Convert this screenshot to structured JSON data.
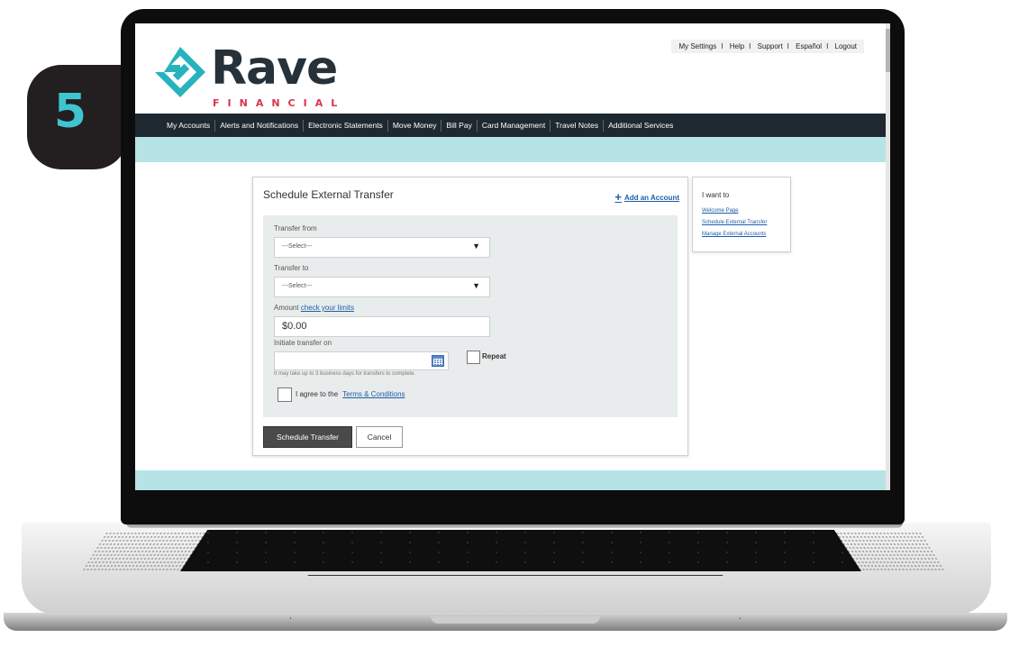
{
  "step": {
    "number": "5"
  },
  "brand": {
    "name": "Rave",
    "tagline": "FINANCIAL",
    "accent": "#26b3bd",
    "secondary": "#d8364b",
    "dark": "#26313a"
  },
  "utility_nav": [
    "My Settings",
    "Help",
    "Support",
    "Español",
    "Logout"
  ],
  "main_nav": [
    "My Accounts",
    "Alerts and Notifications",
    "Electronic Statements",
    "Move Money",
    "Bill Pay",
    "Card Management",
    "Travel Notes",
    "Additional Services"
  ],
  "form": {
    "title": "Schedule External Transfer",
    "add_account": "Add an Account",
    "transfer_from_label": "Transfer from",
    "transfer_from_value": "---Select---",
    "transfer_to_label": "Transfer to",
    "transfer_to_value": "---Select---",
    "amount_label": "Amount",
    "amount_link": "check your limits",
    "amount_value": "$0.00",
    "date_label": "Initiate transfer on",
    "date_value": "",
    "repeat_label": "Repeat",
    "note": "It may take up to 3 business days for transfers to complete.",
    "agree_label": "I agree to the",
    "terms_link": "Terms & Conditions",
    "submit": "Schedule Transfer",
    "cancel": "Cancel"
  },
  "sidebar": {
    "title": "I want to",
    "links": [
      "Welcome Page",
      "Schedule External Transfer",
      "Manage External Accounts"
    ]
  },
  "colors": {
    "nav_bg": "#1d2830",
    "band": "#b6e3e5",
    "link": "#1d5fa8",
    "panel": "#e9ecec"
  }
}
